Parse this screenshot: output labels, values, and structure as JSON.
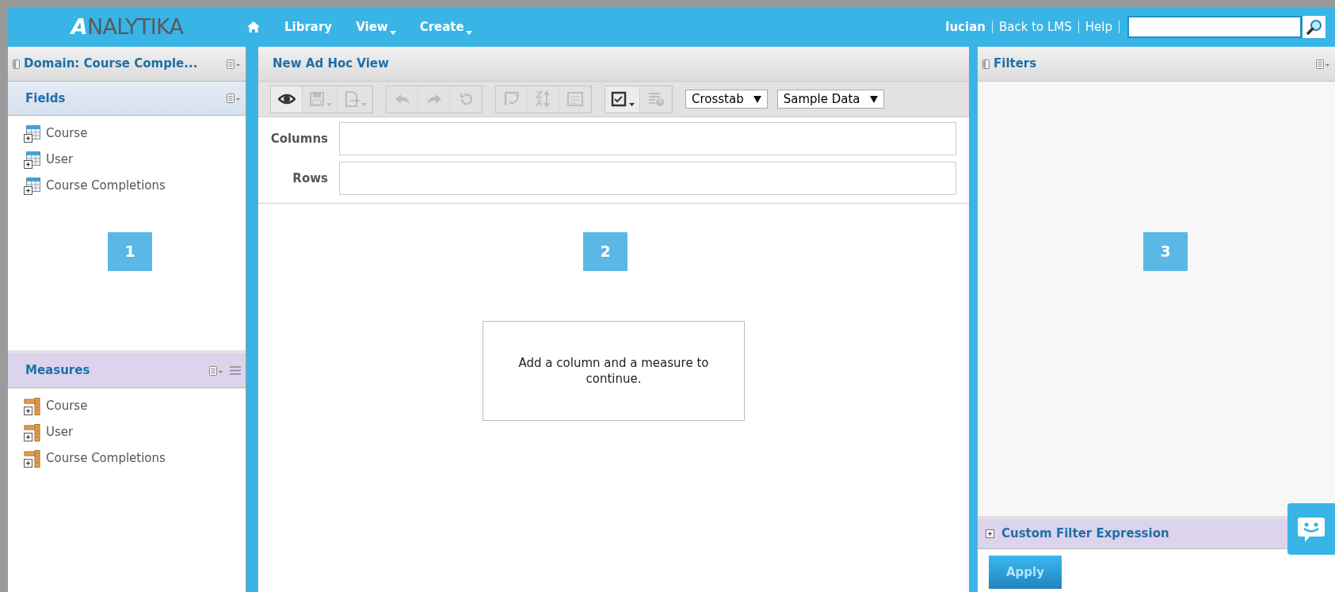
{
  "header": {
    "logo_mark": "A",
    "logo_text": "NALYTIKA",
    "nav": [
      {
        "label": "Library",
        "dropdown": false
      },
      {
        "label": "View",
        "dropdown": true
      },
      {
        "label": "Create",
        "dropdown": true
      }
    ],
    "user": "lucian",
    "links": [
      "Back to LMS",
      "Help"
    ]
  },
  "left_panel": {
    "title": "Domain: Course Comple...",
    "fields": {
      "title": "Fields",
      "items": [
        "Course",
        "User",
        "Course Completions"
      ]
    },
    "measures": {
      "title": "Measures",
      "items": [
        "Course",
        "User",
        "Course Completions"
      ]
    }
  },
  "center": {
    "title": "New Ad Hoc View",
    "toolbar": [
      {
        "buttons": [
          {
            "kind": "eye",
            "dropdown": false,
            "disabled": false
          },
          {
            "kind": "save",
            "dropdown": true,
            "disabled": true
          },
          {
            "kind": "export",
            "dropdown": true,
            "disabled": true
          }
        ]
      },
      {
        "buttons": [
          {
            "kind": "undo",
            "dropdown": false,
            "disabled": true
          },
          {
            "kind": "redo",
            "dropdown": false,
            "disabled": true
          },
          {
            "kind": "reset",
            "dropdown": false,
            "disabled": true
          }
        ]
      },
      {
        "buttons": [
          {
            "kind": "pivot",
            "dropdown": false,
            "disabled": true
          },
          {
            "kind": "sort",
            "dropdown": false,
            "disabled": true
          },
          {
            "kind": "layout",
            "dropdown": false,
            "disabled": true
          }
        ]
      },
      {
        "buttons": [
          {
            "kind": "check",
            "dropdown": true,
            "disabled": false
          },
          {
            "kind": "filterhelp",
            "dropdown": false,
            "disabled": true
          }
        ]
      }
    ],
    "view_type": "Crosstab",
    "data_mode": "Sample Data",
    "columns_label": "Columns",
    "rows_label": "Rows",
    "message": "Add a column and a measure to continue."
  },
  "right_panel": {
    "title": "Filters",
    "custom_filter": "Custom Filter Expression",
    "apply": {
      "label": "Apply",
      "disabled": true
    }
  },
  "markers": [
    "1",
    "2",
    "3"
  ]
}
